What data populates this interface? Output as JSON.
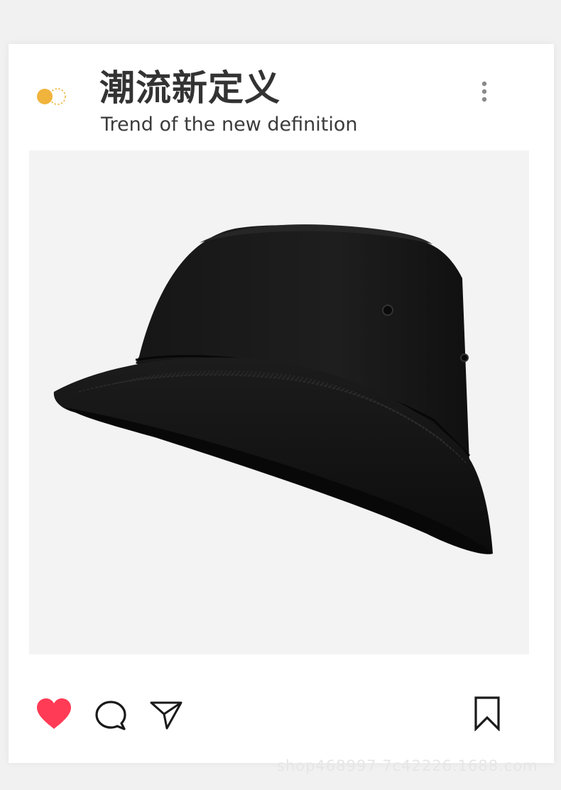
{
  "post": {
    "title": "潮流新定义",
    "subtitle": "Trend of the new definition"
  },
  "icons": {
    "toggle": "toggle-icon",
    "more": "more-vertical-icon",
    "like": "heart-icon",
    "comment": "comment-icon",
    "share": "send-icon",
    "save": "bookmark-icon"
  },
  "image": {
    "subject": "black bucket hat"
  },
  "state": {
    "liked": true
  },
  "colors": {
    "accent": "#f0b43c",
    "like": "#ff3b55",
    "text": "#333333"
  },
  "watermark": "shop468997 7c42226.1688.com"
}
